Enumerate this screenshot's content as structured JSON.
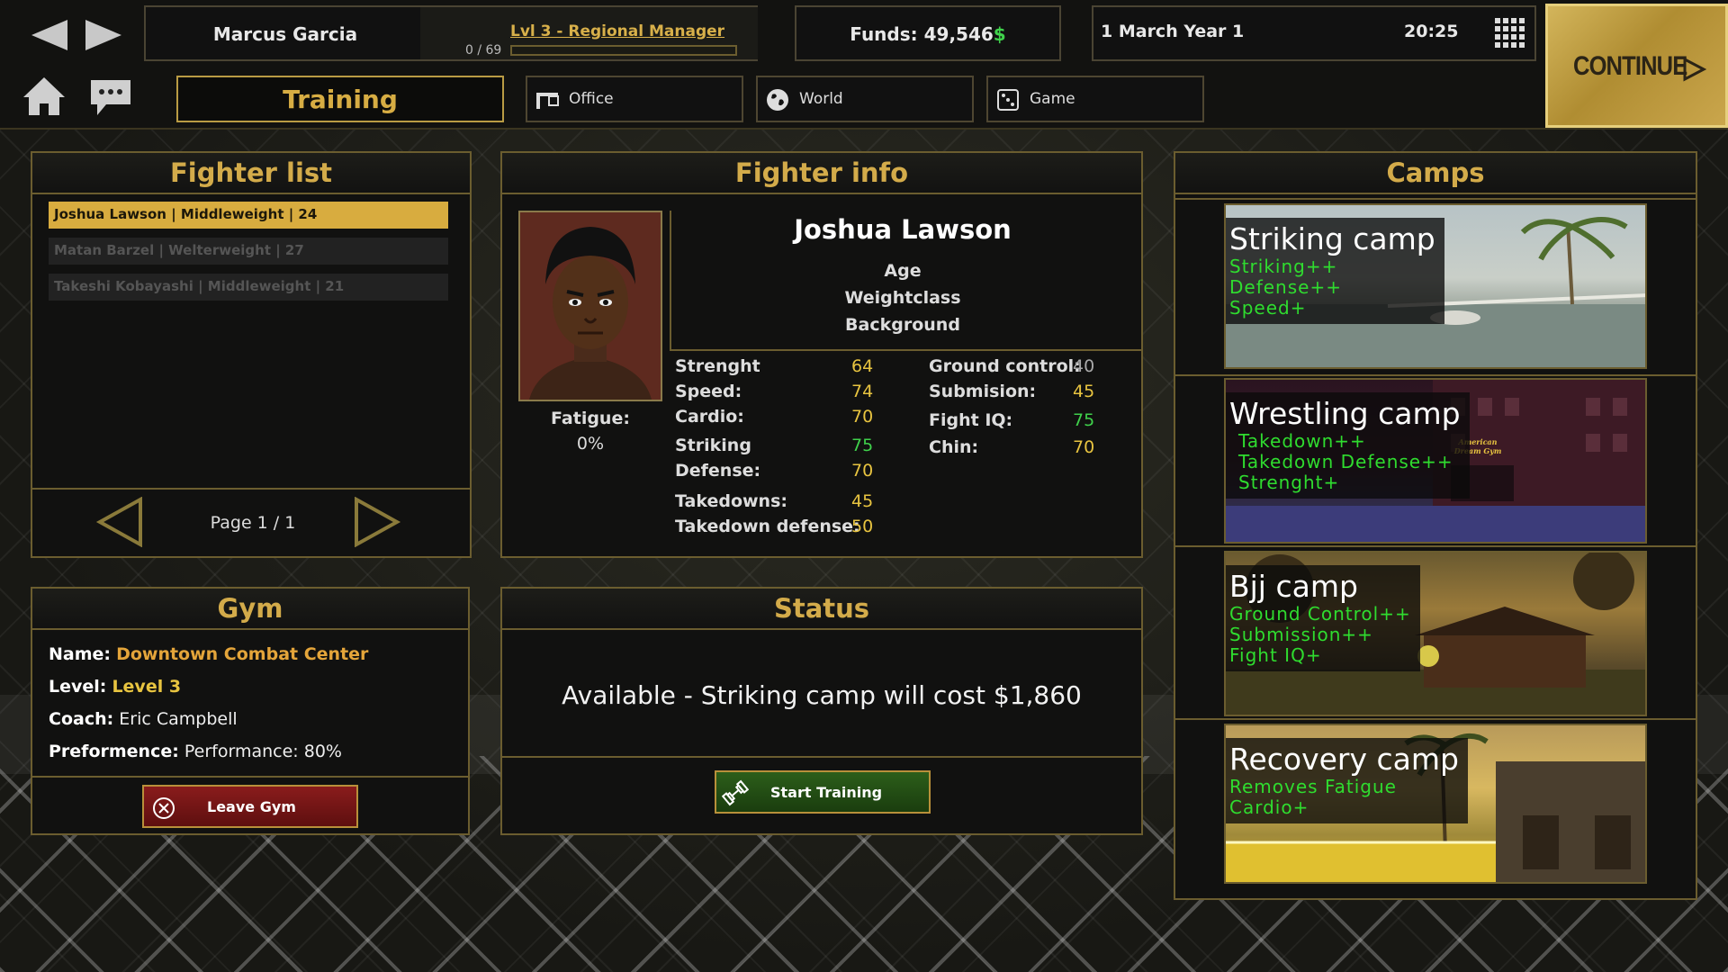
{
  "header": {
    "player_name": "Marcus Garcia",
    "level_title": "Lvl 3 - Regional Manager",
    "xp_text": "0 / 69",
    "xp_fraction": 0.0,
    "funds_label": "Funds: 49,546",
    "funds_currency": "$",
    "date": "1 March Year 1",
    "time": "20:25",
    "continue_label": "CONTINUE"
  },
  "tabs": {
    "active": "Training",
    "office": "Office",
    "world": "World",
    "game": "Game"
  },
  "fighter_list": {
    "title": "Fighter list",
    "items": [
      "Joshua Lawson  |  Middleweight  |  24",
      "Matan Barzel  |  Welterweight  |  27",
      "Takeshi Kobayashi  |  Middleweight  |  21"
    ],
    "page_text": "Page 1 / 1"
  },
  "fighter_info": {
    "title": "Fighter info",
    "name": "Joshua Lawson",
    "age_label": "Age",
    "weightclass_label": "Weightclass",
    "background_label": "Background",
    "fatigue_label": "Fatigue:",
    "fatigue_value": "0%",
    "stats_left": [
      {
        "label": "Strenght",
        "value": "64",
        "color": "#e8c440"
      },
      {
        "label": "Speed:",
        "value": "74",
        "color": "#e8c440"
      },
      {
        "label": "Cardio:",
        "value": "70",
        "color": "#e8c440"
      },
      {
        "label": "Striking",
        "value": "75",
        "color": "#3fd14b"
      },
      {
        "label": "Defense:",
        "value": "70",
        "color": "#e8c440"
      },
      {
        "label": "Takedowns:",
        "value": "45",
        "color": "#e8c440"
      },
      {
        "label": "Takedown defense:",
        "value": "50",
        "color": "#e8c440"
      }
    ],
    "stats_right": [
      {
        "label": "Ground control:",
        "value": "40",
        "color": "#aaaaaa"
      },
      {
        "label": "Submision:",
        "value": "45",
        "color": "#e8c440"
      },
      {
        "label": "Fight IQ:",
        "value": "75",
        "color": "#3fd14b"
      },
      {
        "label": "Chin:",
        "value": "70",
        "color": "#e8c440"
      }
    ]
  },
  "gym": {
    "title": "Gym",
    "name_label": "Name:",
    "name_value": "Downtown Combat Center",
    "level_label": "Level:",
    "level_value": "Level 3",
    "coach_label": "Coach:",
    "coach_value": "Eric Campbell",
    "perf_label": "Preformence:",
    "perf_value": "Performance: 80%",
    "leave_label": "Leave Gym"
  },
  "status": {
    "title": "Status",
    "message": "Available - Striking camp will cost $1,860",
    "start_label": "Start Training"
  },
  "camps": {
    "title": "Camps",
    "items": [
      {
        "name": "Striking camp",
        "lines": [
          "Striking++",
          "Defense++",
          "Speed+"
        ]
      },
      {
        "name": "Wrestling camp",
        "lines": [
          "Takedown++",
          "Takedown Defense++",
          "Strenght+"
        ],
        "sign": "American Dream Gym"
      },
      {
        "name": "Bjj camp",
        "lines": [
          "Ground Control++",
          "Submission++",
          "Fight IQ+"
        ]
      },
      {
        "name": "Recovery camp",
        "lines": [
          "Removes Fatigue",
          "Cardio+"
        ]
      }
    ]
  },
  "colors": {
    "gold": "#d3ab4a",
    "green": "#3fd14b",
    "yellow": "#e8c440",
    "orange": "#e4a53a"
  }
}
